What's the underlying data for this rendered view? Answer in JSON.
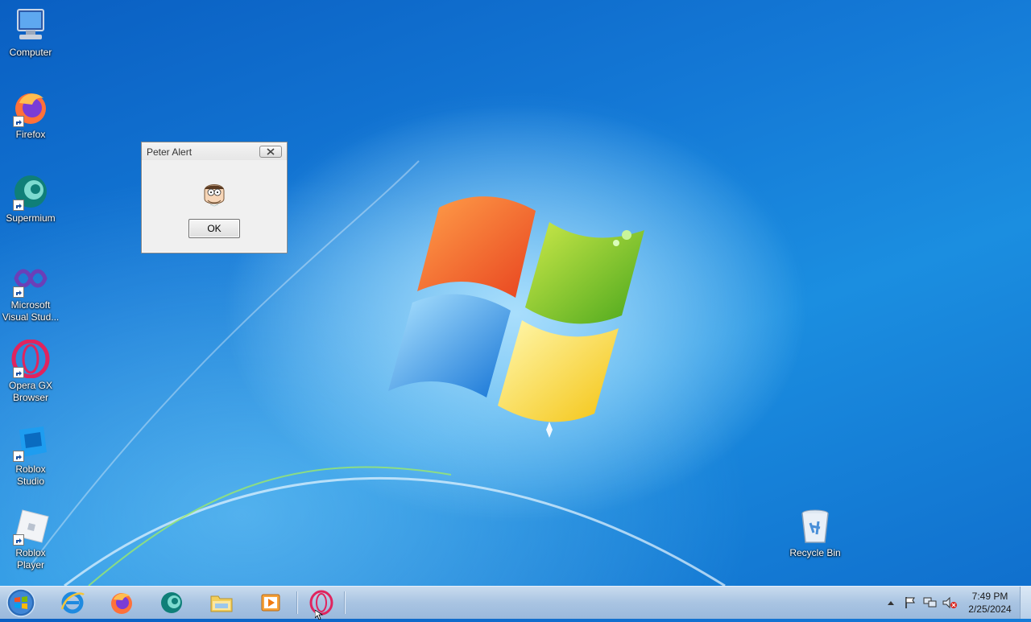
{
  "desktop": {
    "icons": [
      {
        "label": "Computer",
        "icon": "computer-icon"
      },
      {
        "label": "Firefox",
        "icon": "firefox-icon"
      },
      {
        "label": "Supermium",
        "icon": "supermium-icon"
      },
      {
        "label": "Microsoft Visual Stud...",
        "icon": "visual-studio-icon"
      },
      {
        "label": "Opera GX Browser",
        "icon": "opera-gx-icon"
      },
      {
        "label": "Roblox Studio",
        "icon": "roblox-studio-icon"
      },
      {
        "label": "Roblox Player",
        "icon": "roblox-player-icon"
      },
      {
        "label": "Recycle Bin",
        "icon": "recycle-bin-icon"
      }
    ]
  },
  "dialog": {
    "title": "Peter Alert",
    "ok_label": "OK",
    "image": "peter-face-icon"
  },
  "taskbar": {
    "pinned": [
      "internet-explorer-icon",
      "firefox-icon",
      "supermium-icon",
      "file-explorer-icon",
      "media-player-icon",
      "opera-gx-icon"
    ],
    "tray": [
      "show-hidden-icons",
      "action-center-flag-icon",
      "network-icon",
      "volume-muted-icon"
    ],
    "clock_time": "7:49 PM",
    "clock_date": "2/25/2024"
  },
  "colors": {
    "wallpaper_blue": "#1479d6",
    "taskbar": "#b3cbe6",
    "opera_red": "#e0245e"
  }
}
